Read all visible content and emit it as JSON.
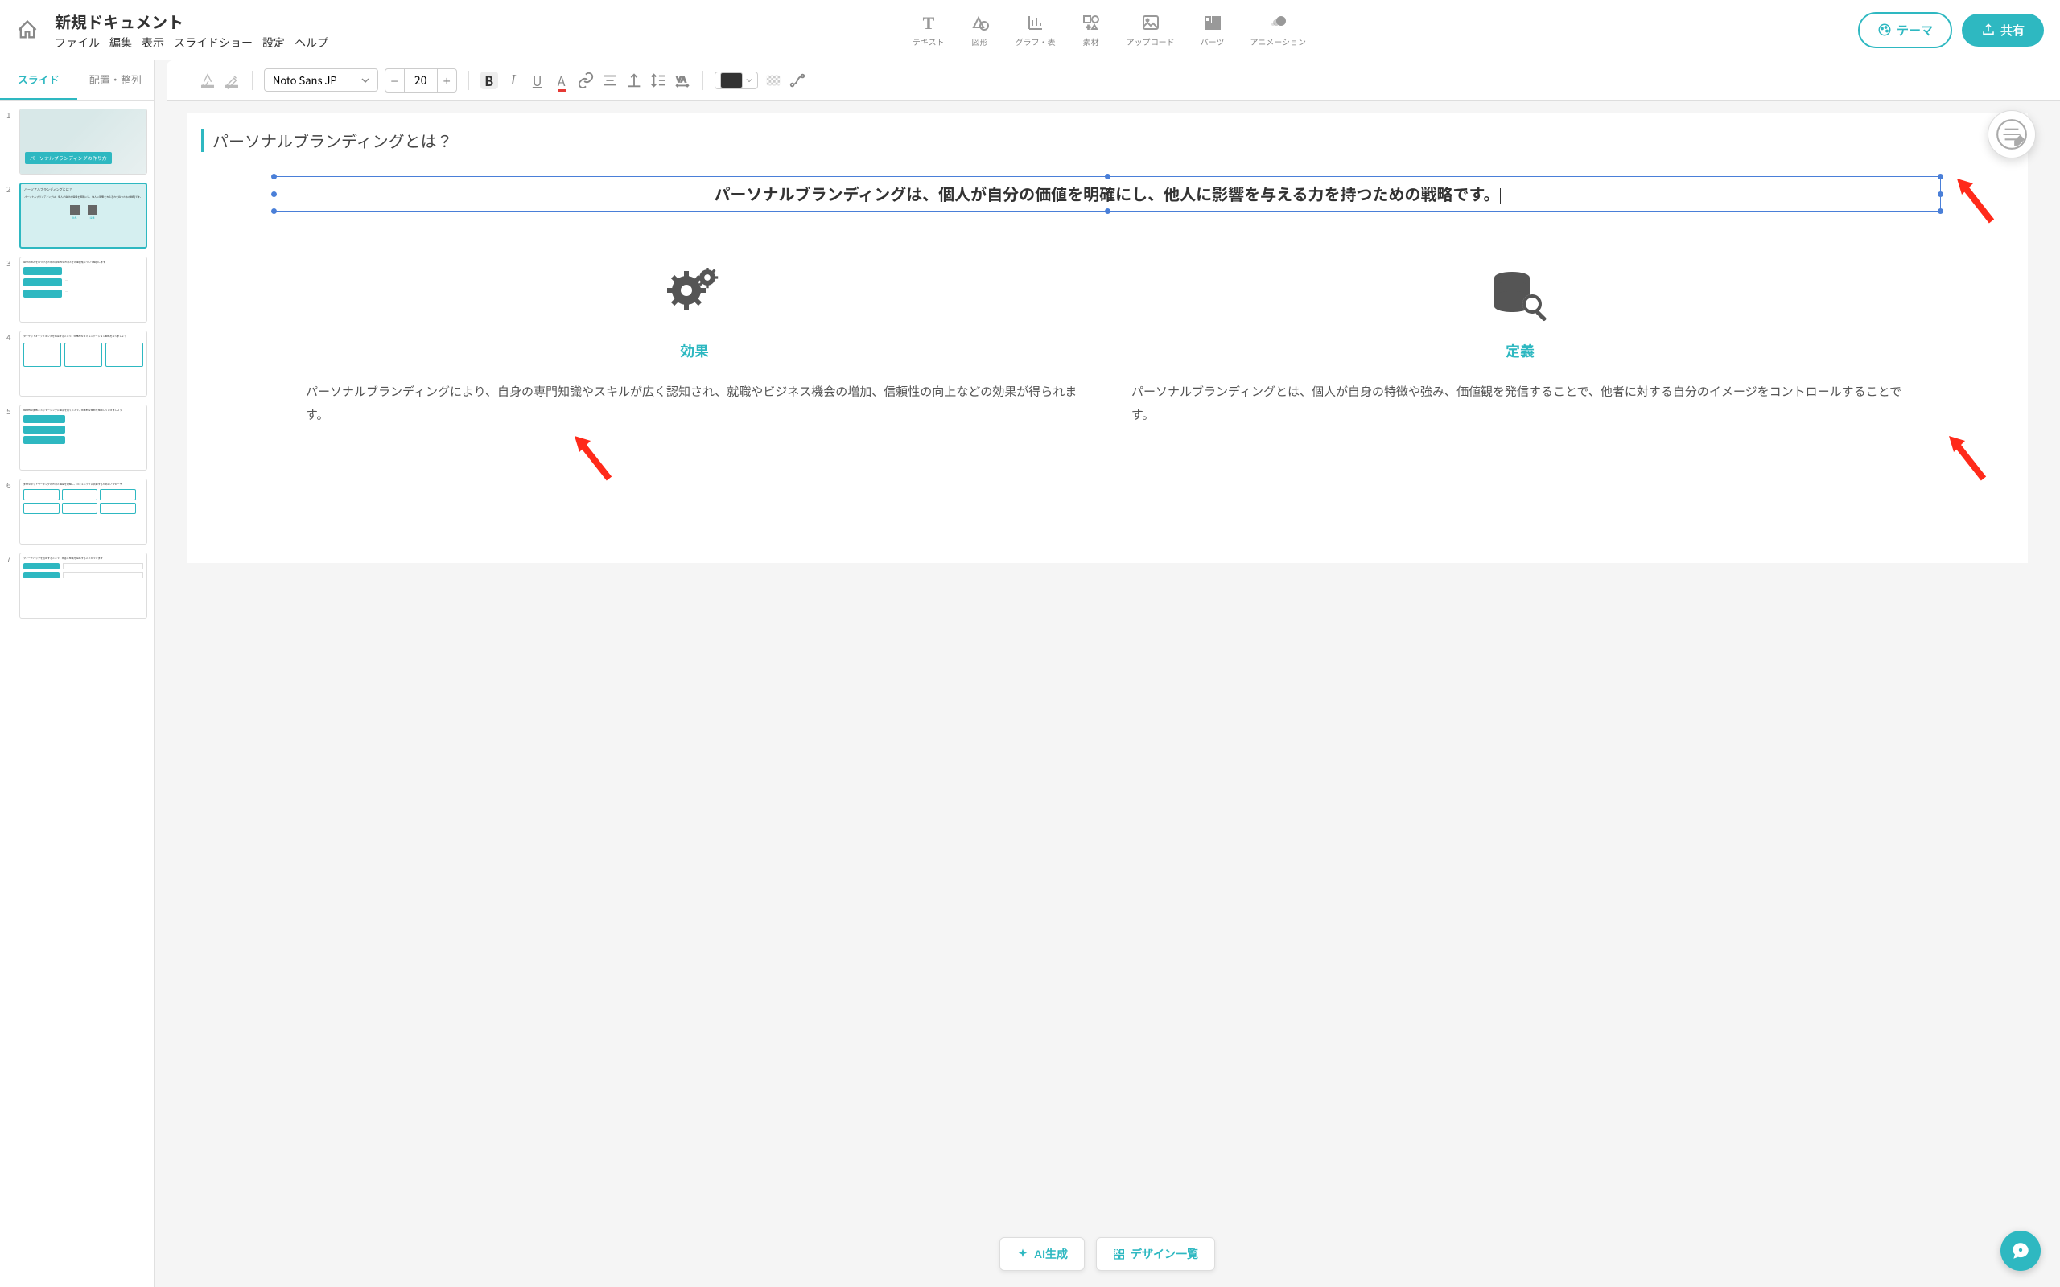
{
  "header": {
    "doc_title": "新規ドキュメント",
    "menu": [
      "ファイル",
      "編集",
      "表示",
      "スライドショー",
      "設定",
      "ヘルプ"
    ],
    "tools": [
      {
        "label": "テキスト",
        "icon": "text"
      },
      {
        "label": "図形",
        "icon": "shape"
      },
      {
        "label": "グラフ・表",
        "icon": "chart"
      },
      {
        "label": "素材",
        "icon": "assets"
      },
      {
        "label": "アップロード",
        "icon": "upload"
      },
      {
        "label": "パーツ",
        "icon": "parts"
      },
      {
        "label": "アニメーション",
        "icon": "animation"
      }
    ],
    "theme_btn": "テーマ",
    "share_btn": "共有"
  },
  "sidebar": {
    "tabs": [
      "スライド",
      "配置・整列"
    ],
    "active_tab": 0,
    "slides": [
      {
        "num": "1",
        "title": "パーソナルブランディングの作り方"
      },
      {
        "num": "2",
        "active": true
      },
      {
        "num": "3"
      },
      {
        "num": "4"
      },
      {
        "num": "5"
      },
      {
        "num": "6"
      },
      {
        "num": "7"
      }
    ]
  },
  "format_bar": {
    "font_name": "Noto Sans JP",
    "font_size": "20"
  },
  "slide": {
    "title": "パーソナルブランディングとは？",
    "headline": "パーソナルブランディングは、個人が自分の価値を明確にし、他人に影響を与える力を持つための戦略です。",
    "columns": [
      {
        "title": "効果",
        "text": "パーソナルブランディングにより、自身の専門知識やスキルが広く認知され、就職やビジネス機会の増加、信頼性の向上などの効果が得られます。"
      },
      {
        "title": "定義",
        "text": "パーソナルブランディングとは、個人が自身の特徴や強み、価値観を発信することで、他者に対する自分のイメージをコントロールすることです。"
      }
    ]
  },
  "bottom": {
    "ai_generate": "AI生成",
    "design_list": "デザイン一覧"
  }
}
